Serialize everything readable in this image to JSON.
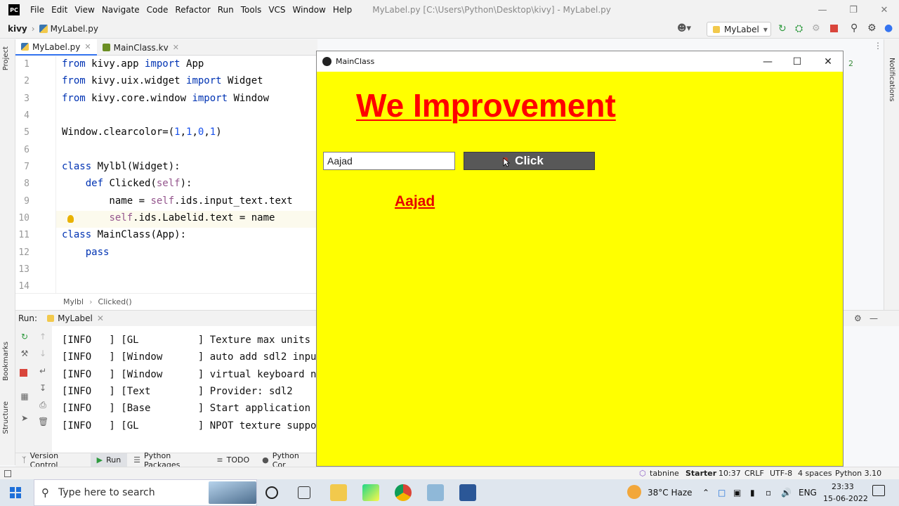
{
  "app": {
    "menu": [
      "File",
      "Edit",
      "View",
      "Navigate",
      "Code",
      "Refactor",
      "Run",
      "Tools",
      "VCS",
      "Window",
      "Help"
    ],
    "window_title": "MyLabel.py [C:\\Users\\Python\\Desktop\\kivy] - MyLabel.py",
    "logo_text": "PC"
  },
  "nav": {
    "project": "kivy",
    "file": "MyLabel.py",
    "run_config": "MyLabel"
  },
  "left_stripe": {
    "project": "Project",
    "bookmarks": "Bookmarks",
    "structure": "Structure"
  },
  "right_stripe": {
    "notifications": "Notifications"
  },
  "tabs": [
    {
      "label": "MyLabel.py",
      "active": true
    },
    {
      "label": "MainClass.kv",
      "active": false
    }
  ],
  "editor": {
    "line_numbers": [
      "1",
      "2",
      "3",
      "4",
      "5",
      "6",
      "7",
      "8",
      "9",
      "10",
      "11",
      "12",
      "13",
      "14"
    ],
    "inspection_count": "2"
  },
  "breadcrumb": {
    "class_name": "Mylbl",
    "method": "Clicked()"
  },
  "run_panel": {
    "run_label": "Run:",
    "config": "MyLabel",
    "lines": [
      "[INFO   ] [GL          ] Texture max units",
      "[INFO   ] [Window      ] auto add sdl2 inpu",
      "[INFO   ] [Window      ] virtual keyboard n",
      "[INFO   ] [Text        ] Provider: sdl2",
      "[INFO   ] [Base        ] Start application",
      "[INFO   ] [GL          ] NPOT texture suppo"
    ]
  },
  "bottom_tabs": [
    "Version Control",
    "Run",
    "Python Packages",
    "TODO",
    "Python Cor"
  ],
  "status_bar": {
    "tabnine": "tabnine",
    "tabnine_plan": "Starter",
    "position": "10:37",
    "line_sep": "CRLF",
    "encoding": "UTF-8",
    "indent": "4 spaces",
    "interpreter": "Python 3.10"
  },
  "kivy_window": {
    "title": "MainClass",
    "heading": "We Improvement",
    "input_value": "Aajad",
    "button_label": "Click",
    "label_text": "Aajad",
    "bg_color": "#ffff00",
    "heading_color": "#ff0000"
  },
  "taskbar": {
    "search_placeholder": "Type here to search",
    "weather": "38°C  Haze",
    "language": "ENG",
    "time": "23:33",
    "date": "15-06-2022"
  }
}
